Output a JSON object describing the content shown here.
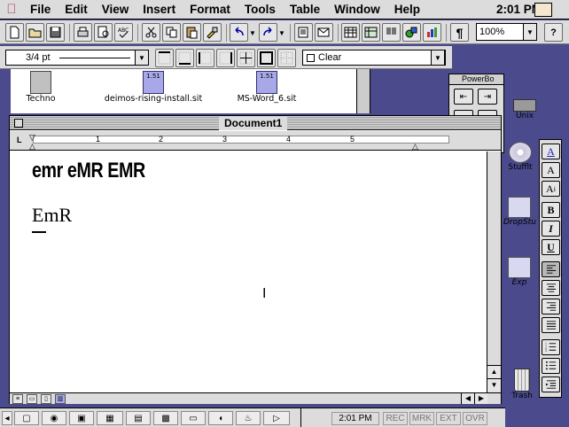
{
  "menubar": {
    "items": [
      "File",
      "Edit",
      "View",
      "Insert",
      "Format",
      "Tools",
      "Table",
      "Window",
      "Help"
    ],
    "clock": "2:01 PM"
  },
  "toolbar": {
    "zoom": "100%",
    "paragraph_mark": "¶",
    "help": "?"
  },
  "borders_bar": {
    "line_style": "3/4 pt",
    "shading": "Clear"
  },
  "finder": {
    "files": [
      {
        "name": "Techno",
        "icon": "folder-icon"
      },
      {
        "name": "deimos-rising-install.sit",
        "icon": "stuffit-archive-icon",
        "badge": "1.51"
      },
      {
        "name": "MS-Word_6.sit",
        "icon": "stuffit-archive-icon",
        "badge": "1.51"
      }
    ]
  },
  "powerbook": {
    "title": "PowerBo"
  },
  "document": {
    "title": "Document1",
    "line1": "emr eMR EMR",
    "line2": "EmR",
    "ruler_numbers": [
      "1",
      "2",
      "3",
      "4",
      "5"
    ]
  },
  "desktop": {
    "icons": [
      {
        "label": "Unix",
        "icon": "disk-icon"
      },
      {
        "label": "Stufflt",
        "icon": "cd-icon"
      },
      {
        "label": "DropStu",
        "icon": "dropstuff-icon"
      },
      {
        "label": "Exp",
        "icon": "expander-icon"
      },
      {
        "label": "Trash",
        "icon": "trash-icon"
      }
    ]
  },
  "statusbar": {
    "time": "2:01 PM",
    "rec": "REC",
    "mrk": "MRK",
    "ext": "EXT",
    "ovr": "OVR"
  }
}
